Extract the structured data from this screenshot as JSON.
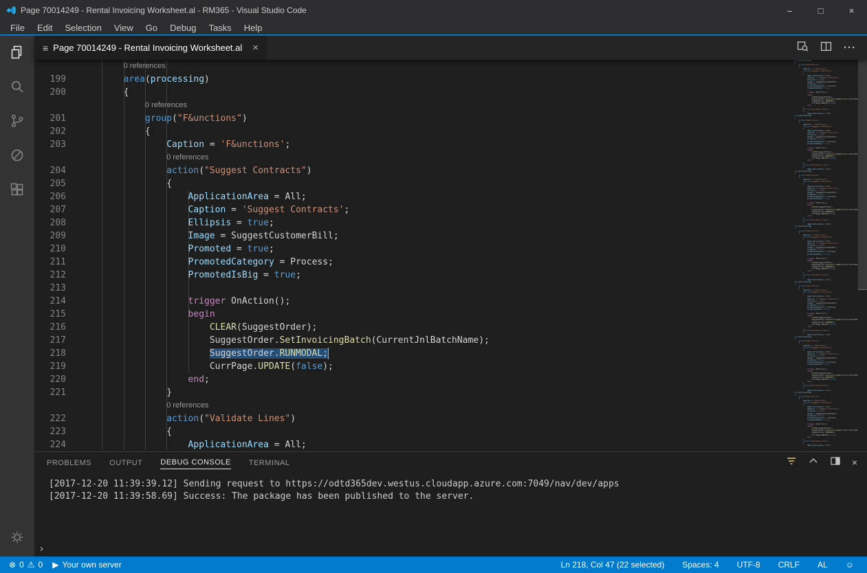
{
  "window": {
    "title": "Page 70014249 - Rental Invoicing Worksheet.al - RM365 - Visual Studio Code",
    "minimize": "–",
    "maximize": "□",
    "close": "×"
  },
  "menu": {
    "items": [
      "File",
      "Edit",
      "Selection",
      "View",
      "Go",
      "Debug",
      "Tasks",
      "Help"
    ]
  },
  "tab": {
    "icon": "≡",
    "label": "Page 70014249 - Rental Invoicing Worksheet.al",
    "close": "×",
    "more": "···"
  },
  "editor": {
    "rows": [
      {
        "type": "lens",
        "indent": 8,
        "text": "0 references"
      },
      {
        "type": "code",
        "num": 199,
        "indent": 8,
        "tokens": [
          [
            "area",
            "kw"
          ],
          [
            "(",
            "pln"
          ],
          [
            "processing",
            "prm"
          ],
          [
            ")",
            "pln"
          ]
        ]
      },
      {
        "type": "code",
        "num": 200,
        "indent": 8,
        "tokens": [
          [
            "{",
            "pln"
          ]
        ]
      },
      {
        "type": "lens",
        "indent": 12,
        "text": "0 references"
      },
      {
        "type": "code",
        "num": 201,
        "indent": 12,
        "tokens": [
          [
            "group",
            "kw"
          ],
          [
            "(",
            "pln"
          ],
          [
            "\"F&unctions\"",
            "str"
          ],
          [
            ")",
            "pln"
          ]
        ]
      },
      {
        "type": "code",
        "num": 202,
        "indent": 12,
        "tokens": [
          [
            "{",
            "pln"
          ]
        ]
      },
      {
        "type": "code",
        "num": 203,
        "indent": 16,
        "tokens": [
          [
            "Caption",
            "prop"
          ],
          [
            " = ",
            "pln"
          ],
          [
            "'F&unctions'",
            "str"
          ],
          [
            ";",
            "pln"
          ]
        ]
      },
      {
        "type": "lens",
        "indent": 16,
        "text": "0 references"
      },
      {
        "type": "code",
        "num": 204,
        "indent": 16,
        "tokens": [
          [
            "action",
            "kw"
          ],
          [
            "(",
            "pln"
          ],
          [
            "\"Suggest Contracts\"",
            "str"
          ],
          [
            ")",
            "pln"
          ]
        ]
      },
      {
        "type": "code",
        "num": 205,
        "indent": 16,
        "tokens": [
          [
            "{",
            "pln"
          ]
        ]
      },
      {
        "type": "code",
        "num": 206,
        "indent": 20,
        "tokens": [
          [
            "ApplicationArea",
            "prop"
          ],
          [
            " = ",
            "pln"
          ],
          [
            "All",
            "id"
          ],
          [
            ";",
            "pln"
          ]
        ]
      },
      {
        "type": "code",
        "num": 207,
        "indent": 20,
        "tokens": [
          [
            "Caption",
            "prop"
          ],
          [
            " = ",
            "pln"
          ],
          [
            "'Suggest Contracts'",
            "str"
          ],
          [
            ";",
            "pln"
          ]
        ]
      },
      {
        "type": "code",
        "num": 208,
        "indent": 20,
        "tokens": [
          [
            "Ellipsis",
            "prop"
          ],
          [
            " = ",
            "pln"
          ],
          [
            "true",
            "bool"
          ],
          [
            ";",
            "pln"
          ]
        ]
      },
      {
        "type": "code",
        "num": 209,
        "indent": 20,
        "tokens": [
          [
            "Image",
            "prop"
          ],
          [
            " = ",
            "pln"
          ],
          [
            "SuggestCustomerBill",
            "id"
          ],
          [
            ";",
            "pln"
          ]
        ]
      },
      {
        "type": "code",
        "num": 210,
        "indent": 20,
        "tokens": [
          [
            "Promoted",
            "prop"
          ],
          [
            " = ",
            "pln"
          ],
          [
            "true",
            "bool"
          ],
          [
            ";",
            "pln"
          ]
        ]
      },
      {
        "type": "code",
        "num": 211,
        "indent": 20,
        "tokens": [
          [
            "PromotedCategory",
            "prop"
          ],
          [
            " = ",
            "pln"
          ],
          [
            "Process",
            "id"
          ],
          [
            ";",
            "pln"
          ]
        ]
      },
      {
        "type": "code",
        "num": 212,
        "indent": 20,
        "tokens": [
          [
            "PromotedIsBig",
            "prop"
          ],
          [
            " = ",
            "pln"
          ],
          [
            "true",
            "bool"
          ],
          [
            ";",
            "pln"
          ]
        ]
      },
      {
        "type": "code",
        "num": 213,
        "indent": 0,
        "tokens": []
      },
      {
        "type": "code",
        "num": 214,
        "indent": 20,
        "tokens": [
          [
            "trigger",
            "ctl"
          ],
          [
            " ",
            "pln"
          ],
          [
            "OnAction",
            "id"
          ],
          [
            "();",
            "pln"
          ]
        ]
      },
      {
        "type": "code",
        "num": 215,
        "indent": 20,
        "tokens": [
          [
            "begin",
            "ctl"
          ]
        ]
      },
      {
        "type": "code",
        "num": 216,
        "indent": 24,
        "tokens": [
          [
            "CLEAR",
            "fn"
          ],
          [
            "(",
            "pln"
          ],
          [
            "SuggestOrder",
            "id"
          ],
          [
            ");",
            "pln"
          ]
        ]
      },
      {
        "type": "code",
        "num": 217,
        "indent": 24,
        "tokens": [
          [
            "SuggestOrder",
            "id"
          ],
          [
            ".",
            "pln"
          ],
          [
            "SetInvoicingBatch",
            "fn"
          ],
          [
            "(",
            "pln"
          ],
          [
            "CurrentJnlBatchName",
            "id"
          ],
          [
            ");",
            "pln"
          ]
        ]
      },
      {
        "type": "code",
        "num": 218,
        "indent": 24,
        "selected": true,
        "tokens": [
          [
            "SuggestOrder",
            "id"
          ],
          [
            ".",
            "pln"
          ],
          [
            "RUNMODAL",
            "fn"
          ],
          [
            ";",
            "pln"
          ]
        ]
      },
      {
        "type": "code",
        "num": 219,
        "indent": 24,
        "tokens": [
          [
            "CurrPage",
            "id"
          ],
          [
            ".",
            "pln"
          ],
          [
            "UPDATE",
            "fn"
          ],
          [
            "(",
            "pln"
          ],
          [
            "false",
            "bool"
          ],
          [
            ");",
            "pln"
          ]
        ]
      },
      {
        "type": "code",
        "num": 220,
        "indent": 20,
        "tokens": [
          [
            "end",
            "ctl"
          ],
          [
            ";",
            "pln"
          ]
        ]
      },
      {
        "type": "code",
        "num": 221,
        "indent": 16,
        "tokens": [
          [
            "}",
            "pln"
          ]
        ]
      },
      {
        "type": "lens",
        "indent": 16,
        "text": "0 references"
      },
      {
        "type": "code",
        "num": 222,
        "indent": 16,
        "tokens": [
          [
            "action",
            "kw"
          ],
          [
            "(",
            "pln"
          ],
          [
            "\"Validate Lines\"",
            "str"
          ],
          [
            ")",
            "pln"
          ]
        ]
      },
      {
        "type": "code",
        "num": 223,
        "indent": 16,
        "tokens": [
          [
            "{",
            "pln"
          ]
        ]
      },
      {
        "type": "code",
        "num": 224,
        "indent": 20,
        "tokens": [
          [
            "ApplicationArea",
            "prop"
          ],
          [
            " = ",
            "pln"
          ],
          [
            "All",
            "id"
          ],
          [
            ";",
            "pln"
          ]
        ]
      }
    ]
  },
  "panel": {
    "tabs": [
      "PROBLEMS",
      "OUTPUT",
      "DEBUG CONSOLE",
      "TERMINAL"
    ],
    "active_tab": "DEBUG CONSOLE",
    "console_lines": [
      "[2017-12-20 11:39:39.12] Sending request to https://odtd365dev.westus.cloudapp.azure.com:7049/nav/dev/apps",
      "[2017-12-20 11:39:58.69] Success: The package has been published to the server."
    ],
    "prompt": "›",
    "close": "×"
  },
  "status": {
    "error_icon": "⊗",
    "errors": "0",
    "warning_icon": "⚠",
    "warnings": "0",
    "server_icon": "▶",
    "server": "Your own server",
    "cursor": "Ln 218, Col 47 (22 selected)",
    "spaces": "Spaces: 4",
    "encoding": "UTF-8",
    "eol": "CRLF",
    "language": "AL",
    "feedback_icon": "☺"
  },
  "colors": {
    "accent": "#007acc",
    "selection": "#264f78",
    "titlebar": "#2d2d30",
    "activitybar": "#333333",
    "editor_bg": "#1e1e1e",
    "statusbar": "#007acc",
    "tokens": {
      "kw": "#569cd6",
      "ctl": "#c586c0",
      "str": "#ce9178",
      "prop": "#9cdcfe",
      "id": "#d4d4d4",
      "fn": "#dcdcaa",
      "bool": "#569cd6",
      "pln": "#d4d4d4",
      "prm": "#9cdcfe",
      "lens": "#999999"
    }
  }
}
